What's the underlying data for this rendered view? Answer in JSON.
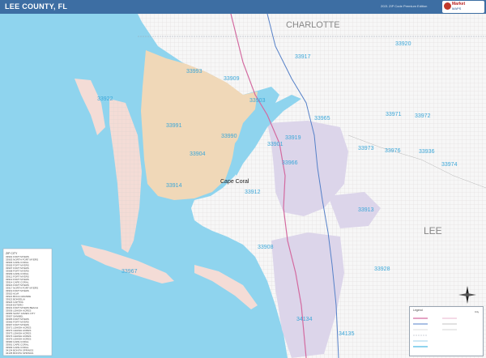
{
  "header": {
    "title": "LEE COUNTY, FL",
    "edition": "2021 ZIP Code Premium Edition",
    "brand_line1": "Market",
    "brand_line2": "MAPS"
  },
  "map": {
    "colors": {
      "water": "#8fd4ee",
      "land_pink": "#f4dcd6",
      "land_tan": "#f0d8b8",
      "land_lavender": "#dcd5ea",
      "land_white": "#f7f7f7",
      "roads": "#c8c8c8",
      "highway_pink": "#d36aa0",
      "highway_blue": "#5580c8",
      "zip_label": "#3aa6d8",
      "county_label": "#888888"
    },
    "county_labels": [
      "CHARLOTTE",
      "LEE"
    ],
    "city_labels": [
      "Cape Coral"
    ],
    "zip_labels": [
      "33920",
      "33917",
      "33993",
      "33909",
      "33922",
      "33903",
      "33991",
      "33965",
      "33971",
      "33972",
      "33990",
      "33904",
      "33919",
      "33901",
      "33973",
      "33976",
      "33936",
      "33974",
      "33914",
      "33966",
      "33913",
      "33912",
      "33908",
      "33967",
      "33928",
      "34134",
      "34135"
    ]
  },
  "zip_table": {
    "header": "ZIP  CITY",
    "rows": [
      "33901 FORT MYERS",
      "33903 NORTH FORT MYERS",
      "33904 CAPE CORAL",
      "33905 FORT MYERS",
      "33907 FORT MYERS",
      "33908 FORT MYERS",
      "33909 CAPE CORAL",
      "33912 FORT MYERS",
      "33913 FORT MYERS",
      "33914 CAPE CORAL",
      "33916 FORT MYERS",
      "33917 NORTH FORT MYERS",
      "33919 FORT MYERS",
      "33920 ALVA",
      "33921 BOCA GRANDE",
      "33922 BOKEELIA",
      "33924 CAPTIVA",
      "33928 ESTERO",
      "33931 FORT MYERS BEACH",
      "33936 LEHIGH ACRES",
      "33956 SAINT JAMES CITY",
      "33957 SANIBEL",
      "33965 FORT MYERS",
      "33966 FORT MYERS",
      "33967 FORT MYERS",
      "33971 LEHIGH ACRES",
      "33972 LEHIGH ACRES",
      "33973 LEHIGH ACRES",
      "33974 LEHIGH ACRES",
      "33976 LEHIGH ACRES",
      "33990 CAPE CORAL",
      "33991 CAPE CORAL",
      "33993 CAPE CORAL",
      "34134 BONITA SPRINGS",
      "34135 BONITA SPRINGS"
    ]
  },
  "legend": {
    "header": "Legend",
    "city_label": "City"
  }
}
